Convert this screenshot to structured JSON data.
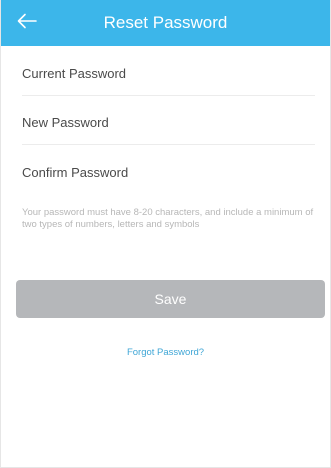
{
  "colors": {
    "accent": "#3cb6ea",
    "button_disabled": "#b5b7ba",
    "link": "#3fa6d6",
    "hint": "#b7b7b7"
  },
  "header": {
    "title": "Reset Password",
    "back_icon": "arrow-left-icon"
  },
  "form": {
    "current_password": {
      "placeholder": "Current Password",
      "value": ""
    },
    "new_password": {
      "placeholder": "New Password",
      "value": ""
    },
    "confirm_password": {
      "placeholder": "Confirm Password",
      "value": ""
    },
    "hint": "Your password must have 8-20 characters, and include a minimum of two types of numbers, letters and symbols"
  },
  "actions": {
    "save_label": "Save",
    "forgot_label": "Forgot Password?"
  }
}
